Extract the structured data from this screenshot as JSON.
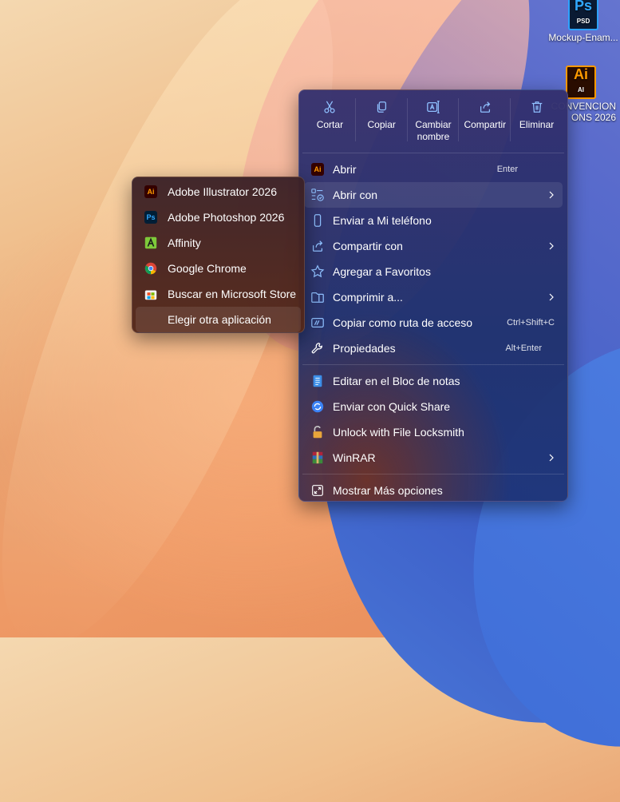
{
  "desktop": {
    "icons": [
      {
        "label": "Mockup-Enam...",
        "type": "Ps",
        "ext": "PSD",
        "icon": "photoshop-file-icon"
      },
      {
        "label": "CONVENCION\nONS 2026",
        "type": "Ai",
        "ext": "AI",
        "icon": "illustrator-file-icon"
      }
    ]
  },
  "context_menu": {
    "quick_actions": [
      {
        "label": "Cortar",
        "icon": "scissors-icon"
      },
      {
        "label": "Copiar",
        "icon": "copy-icon"
      },
      {
        "label": "Cambiar nombre",
        "icon": "rename-icon"
      },
      {
        "label": "Compartir",
        "icon": "share-icon"
      },
      {
        "label": "Eliminar",
        "icon": "trash-icon"
      }
    ],
    "items": [
      {
        "label": "Abrir",
        "shortcut": "Enter",
        "icon": "illustrator-app-icon"
      },
      {
        "label": "Abrir con",
        "icon": "open-with-icon",
        "submenu": true
      },
      {
        "label": "Enviar a Mi teléfono",
        "icon": "phone-icon"
      },
      {
        "label": "Compartir con",
        "icon": "share-with-icon",
        "submenu": true
      },
      {
        "label": "Agregar a Favoritos",
        "icon": "star-icon"
      },
      {
        "label": "Comprimir a...",
        "icon": "zip-folder-icon",
        "submenu": true
      },
      {
        "label": "Copiar como ruta de acceso",
        "shortcut": "Ctrl+Shift+C",
        "icon": "copy-path-icon"
      },
      {
        "label": "Propiedades",
        "shortcut": "Alt+Enter",
        "icon": "wrench-icon"
      },
      {
        "label": "Editar en el Bloc de notas",
        "icon": "notepad-icon"
      },
      {
        "label": "Enviar con Quick Share",
        "icon": "quick-share-icon"
      },
      {
        "label": "Unlock with File Locksmith",
        "icon": "lock-icon"
      },
      {
        "label": "WinRAR",
        "icon": "winrar-icon",
        "submenu": true
      },
      {
        "label": "Mostrar Más opciones",
        "icon": "more-options-icon"
      }
    ]
  },
  "open_with_submenu": {
    "items": [
      {
        "label": "Adobe Illustrator 2026",
        "icon": "illustrator-app-icon"
      },
      {
        "label": "Adobe Photoshop 2026",
        "icon": "photoshop-app-icon"
      },
      {
        "label": "Affinity",
        "icon": "affinity-icon"
      },
      {
        "label": "Google Chrome",
        "icon": "chrome-icon"
      },
      {
        "label": "Buscar en Microsoft Store",
        "icon": "store-icon"
      },
      {
        "label": "Elegir otra aplicación",
        "icon": ""
      }
    ]
  },
  "colors": {
    "accent": "#60a5ff",
    "illustrator": "#ff9a00",
    "photoshop": "#31a8ff"
  }
}
